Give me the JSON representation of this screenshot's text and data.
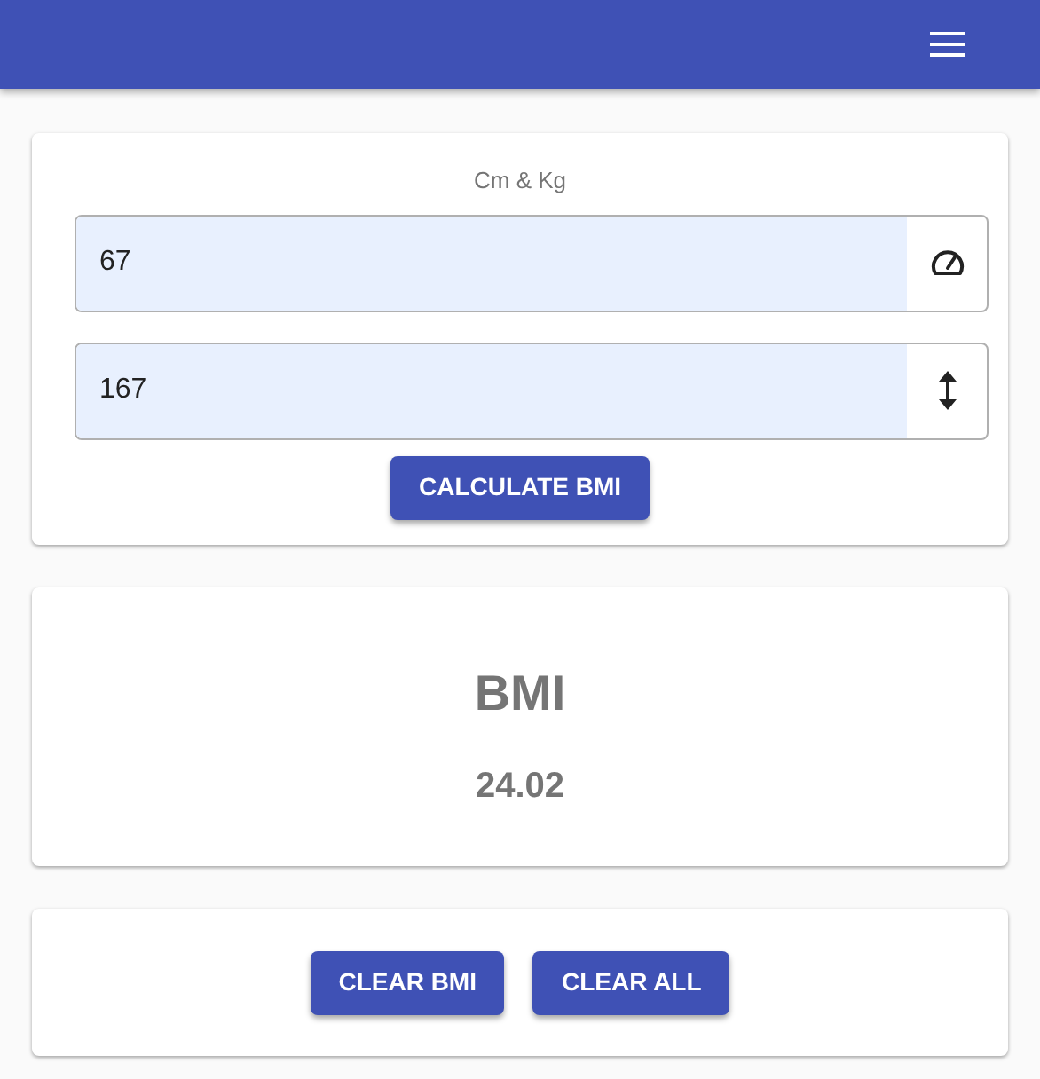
{
  "form": {
    "units_label": "Cm & Kg",
    "fields": [
      {
        "kind": "weight",
        "value": "67"
      },
      {
        "kind": "height",
        "value": "167"
      }
    ],
    "button": "CALCULATE BMI"
  },
  "result": {
    "title": "BMI",
    "value": "24.02"
  },
  "actions": [
    "CLEAR BMI",
    "CLEAR ALL"
  ]
}
